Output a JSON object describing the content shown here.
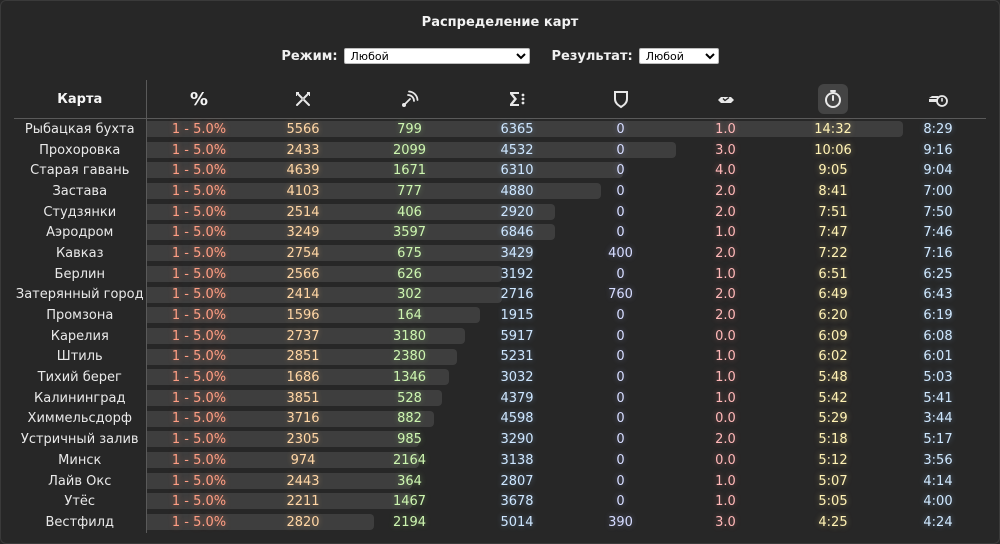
{
  "title": "Распределение карт",
  "filters": {
    "mode_label": "Режим:",
    "mode_value": "Любой",
    "result_label": "Результат:",
    "result_value": "Любой"
  },
  "columns": {
    "map": "Карта",
    "percent": "%",
    "icons": [
      "frags-icon",
      "spot-icon",
      "total-icon",
      "defense-icon",
      "capture-icon",
      "timer-icon",
      "tank-timer-icon"
    ]
  },
  "rows": [
    {
      "map": "Рыбацкая бухта",
      "pct": "1 - 5.0%",
      "kills": "5566",
      "spot": "799",
      "sum": "6365",
      "def": "0",
      "cap": "1.0",
      "time": "14:32",
      "time2": "8:29",
      "bar": 1.0
    },
    {
      "map": "Прохоровка",
      "pct": "1 - 5.0%",
      "kills": "2433",
      "spot": "2099",
      "sum": "4532",
      "def": "0",
      "cap": "3.0",
      "time": "10:06",
      "time2": "9:16",
      "bar": 0.7
    },
    {
      "map": "Старая гавань",
      "pct": "1 - 5.0%",
      "kills": "4639",
      "spot": "1671",
      "sum": "6310",
      "def": "0",
      "cap": "4.0",
      "time": "9:05",
      "time2": "9:04",
      "bar": 0.63
    },
    {
      "map": "Застава",
      "pct": "1 - 5.0%",
      "kills": "4103",
      "spot": "777",
      "sum": "4880",
      "def": "0",
      "cap": "2.0",
      "time": "8:41",
      "time2": "7:00",
      "bar": 0.6
    },
    {
      "map": "Студзянки",
      "pct": "1 - 5.0%",
      "kills": "2514",
      "spot": "406",
      "sum": "2920",
      "def": "0",
      "cap": "2.0",
      "time": "7:51",
      "time2": "7:50",
      "bar": 0.54
    },
    {
      "map": "Аэродром",
      "pct": "1 - 5.0%",
      "kills": "3249",
      "spot": "3597",
      "sum": "6846",
      "def": "0",
      "cap": "1.0",
      "time": "7:47",
      "time2": "7:46",
      "bar": 0.54
    },
    {
      "map": "Кавказ",
      "pct": "1 - 5.0%",
      "kills": "2754",
      "spot": "675",
      "sum": "3429",
      "def": "400",
      "cap": "2.0",
      "time": "7:22",
      "time2": "7:16",
      "bar": 0.51
    },
    {
      "map": "Берлин",
      "pct": "1 - 5.0%",
      "kills": "2566",
      "spot": "626",
      "sum": "3192",
      "def": "0",
      "cap": "1.0",
      "time": "6:51",
      "time2": "6:25",
      "bar": 0.47
    },
    {
      "map": "Затерянный город",
      "pct": "1 - 5.0%",
      "kills": "2414",
      "spot": "302",
      "sum": "2716",
      "def": "760",
      "cap": "2.0",
      "time": "6:49",
      "time2": "6:43",
      "bar": 0.47
    },
    {
      "map": "Промзона",
      "pct": "1 - 5.0%",
      "kills": "1596",
      "spot": "164",
      "sum": "1915",
      "def": "0",
      "cap": "2.0",
      "time": "6:20",
      "time2": "6:19",
      "bar": 0.44
    },
    {
      "map": "Карелия",
      "pct": "1 - 5.0%",
      "kills": "2737",
      "spot": "3180",
      "sum": "5917",
      "def": "0",
      "cap": "0.0",
      "time": "6:09",
      "time2": "6:08",
      "bar": 0.42
    },
    {
      "map": "Штиль",
      "pct": "1 - 5.0%",
      "kills": "2851",
      "spot": "2380",
      "sum": "5231",
      "def": "0",
      "cap": "1.0",
      "time": "6:02",
      "time2": "6:01",
      "bar": 0.41
    },
    {
      "map": "Тихий берег",
      "pct": "1 - 5.0%",
      "kills": "1686",
      "spot": "1346",
      "sum": "3032",
      "def": "0",
      "cap": "1.0",
      "time": "5:48",
      "time2": "5:03",
      "bar": 0.4
    },
    {
      "map": "Калининград",
      "pct": "1 - 5.0%",
      "kills": "3851",
      "spot": "528",
      "sum": "4379",
      "def": "0",
      "cap": "1.0",
      "time": "5:42",
      "time2": "5:41",
      "bar": 0.39
    },
    {
      "map": "Химмельсдорф",
      "pct": "1 - 5.0%",
      "kills": "3716",
      "spot": "882",
      "sum": "4598",
      "def": "0",
      "cap": "0.0",
      "time": "5:29",
      "time2": "3:44",
      "bar": 0.38
    },
    {
      "map": "Устричный залив",
      "pct": "1 - 5.0%",
      "kills": "2305",
      "spot": "985",
      "sum": "3290",
      "def": "0",
      "cap": "2.0",
      "time": "5:18",
      "time2": "5:17",
      "bar": 0.36
    },
    {
      "map": "Минск",
      "pct": "1 - 5.0%",
      "kills": "974",
      "spot": "2164",
      "sum": "3138",
      "def": "0",
      "cap": "0.0",
      "time": "5:12",
      "time2": "3:56",
      "bar": 0.36
    },
    {
      "map": "Лайв Окс",
      "pct": "1 - 5.0%",
      "kills": "2443",
      "spot": "364",
      "sum": "2807",
      "def": "0",
      "cap": "1.0",
      "time": "5:07",
      "time2": "4:14",
      "bar": 0.35
    },
    {
      "map": "Утёс",
      "pct": "1 - 5.0%",
      "kills": "2211",
      "spot": "1467",
      "sum": "3678",
      "def": "0",
      "cap": "1.0",
      "time": "5:05",
      "time2": "4:00",
      "bar": 0.35
    },
    {
      "map": "Вестфилд",
      "pct": "1 - 5.0%",
      "kills": "2820",
      "spot": "2194",
      "sum": "5014",
      "def": "390",
      "cap": "3.0",
      "time": "4:25",
      "time2": "4:24",
      "bar": 0.3
    }
  ]
}
